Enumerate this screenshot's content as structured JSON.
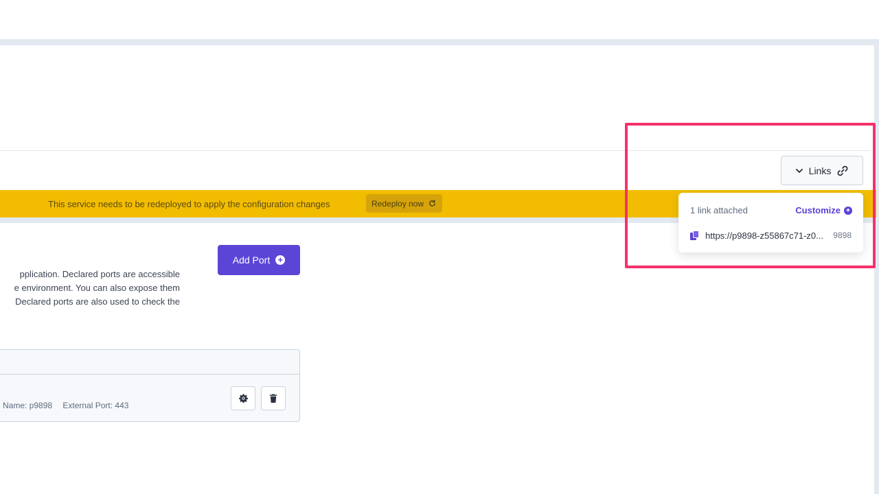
{
  "banner": {
    "message": "This service needs to be redeployed to apply the configuration changes",
    "redeploy_label": "Redeploy now",
    "color": "#f2bd00"
  },
  "links_button": {
    "label": "Links"
  },
  "links_popover": {
    "count_text": "1 link attached",
    "customize_label": "Customize",
    "links": [
      {
        "url": "https://p9898-z55867c71-z0...",
        "port": "9898"
      }
    ]
  },
  "ports": {
    "add_label": "Add Port",
    "description_lines": [
      "pplication. Declared ports are accessible",
      "e environment. You can also expose them",
      "Declared ports are also used to check the"
    ],
    "rows": [
      {
        "name_text": "Name: p9898",
        "external_text": "External Port: 443"
      }
    ]
  },
  "colors": {
    "accent": "#5b45d6",
    "highlight": "#f5306b"
  }
}
